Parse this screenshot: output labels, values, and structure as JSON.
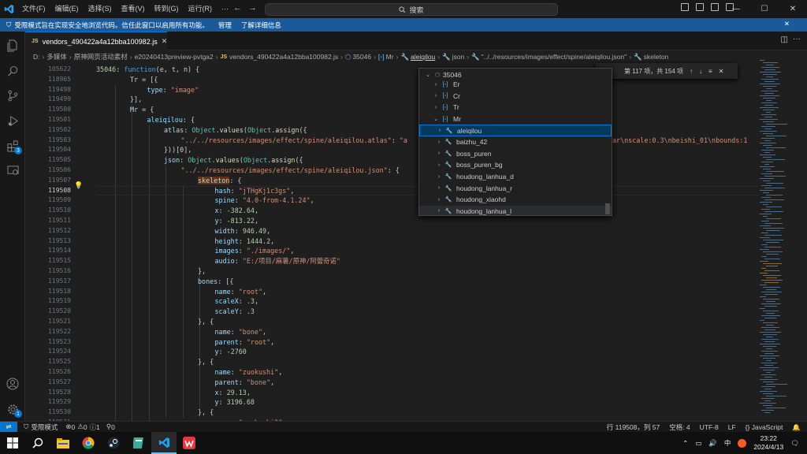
{
  "titlebar": {
    "menu": [
      "文件(F)",
      "编辑(E)",
      "选择(S)",
      "查看(V)",
      "转到(G)",
      "运行(R)",
      "···"
    ],
    "search_label": "搜索"
  },
  "banner": {
    "text": "受限模式旨在实现安全地浏览代码。信任此窗口以启用所有功能。",
    "manage": "管理",
    "learn_more": "了解详细信息"
  },
  "activity": {
    "extensions_badge": "3",
    "settings_badge": "1"
  },
  "tab": {
    "icon": "JS",
    "label": "vendors_490422a4a12bba100982.js"
  },
  "breadcrumb": [
    "D:",
    "多媒体",
    "原神网页活动素材",
    "e20240413preview-pvtga2",
    "vendors_490422a4a12bba100982.js",
    "35046",
    "Mr",
    "aleiqilou",
    "json",
    "\"../../resources/images/effect/spine/aleiqilou.json\"",
    "skeleton"
  ],
  "find": {
    "result": "第 117 项，共 154 项"
  },
  "editor": {
    "lines": [
      {
        "no": "105622",
        "indent": 0,
        "tokens": [
          [
            "n",
            "35046"
          ],
          [
            "",
            ": "
          ],
          [
            "k",
            "function"
          ],
          [
            "",
            "(e, t, n) {"
          ]
        ]
      },
      {
        "no": "118965",
        "indent": 2,
        "tokens": [
          [
            "p",
            "Tr"
          ],
          [
            "",
            " = [{"
          ]
        ]
      },
      {
        "no": "119498",
        "indent": 3,
        "tokens": [
          [
            "p",
            "type"
          ],
          [
            "",
            ": "
          ],
          [
            "s",
            "\"image\""
          ]
        ]
      },
      {
        "no": "119499",
        "indent": 2,
        "tokens": [
          [
            "",
            "}],"
          ]
        ]
      },
      {
        "no": "119500",
        "indent": 2,
        "tokens": [
          [
            "p",
            "Mr"
          ],
          [
            "",
            " = {"
          ]
        ]
      },
      {
        "no": "119501",
        "indent": 3,
        "tokens": [
          [
            "p",
            "aleiqilou"
          ],
          [
            "",
            ": {"
          ]
        ]
      },
      {
        "no": "119502",
        "indent": 4,
        "tokens": [
          [
            "p",
            "atlas"
          ],
          [
            "",
            ": "
          ],
          [
            "t",
            "Object"
          ],
          [
            "",
            "."
          ],
          [
            "f",
            "values"
          ],
          [
            "",
            "("
          ],
          [
            "t",
            "Object"
          ],
          [
            "",
            "."
          ],
          [
            "f",
            "assign"
          ],
          [
            "",
            "({"
          ]
        ]
      },
      {
        "no": "119503",
        "indent": 5,
        "tokens": [
          [
            "s",
            "\"../../resources/images/effect/spine/aleiqilou.atlas\""
          ],
          [
            "",
            ": "
          ],
          [
            "s",
            "\"a"
          ]
        ]
      },
      {
        "no": "119504",
        "indent": 4,
        "tokens": [
          [
            "",
            "}))[0],"
          ]
        ]
      },
      {
        "no": "119505",
        "indent": 4,
        "tokens": [
          [
            "p",
            "json"
          ],
          [
            "",
            ": "
          ],
          [
            "t",
            "Object"
          ],
          [
            "",
            "."
          ],
          [
            "f",
            "values"
          ],
          [
            "",
            "("
          ],
          [
            "t",
            "Object"
          ],
          [
            "",
            "."
          ],
          [
            "f",
            "assign"
          ],
          [
            "",
            "({"
          ]
        ]
      },
      {
        "no": "119506",
        "indent": 5,
        "tokens": [
          [
            "s",
            "\"../../resources/images/effect/spine/aleiqilou.json\""
          ],
          [
            "",
            ": {"
          ]
        ]
      },
      {
        "no": "119507",
        "indent": 6,
        "tokens": [
          [
            "p",
            "skeleton"
          ],
          [
            "",
            ": {"
          ]
        ]
      },
      {
        "no": "119508",
        "indent": 7,
        "tokens": [
          [
            "p",
            "hash"
          ],
          [
            "",
            ": "
          ],
          [
            "s",
            "\"jTHgKj1c3gs\""
          ],
          [
            "",
            ","
          ]
        ]
      },
      {
        "no": "119509",
        "indent": 7,
        "tokens": [
          [
            "p",
            "spine"
          ],
          [
            "",
            ": "
          ],
          [
            "s",
            "\"4.0-from-4.1.24\""
          ],
          [
            "",
            ","
          ]
        ]
      },
      {
        "no": "119510",
        "indent": 7,
        "tokens": [
          [
            "p",
            "x"
          ],
          [
            "",
            ": "
          ],
          [
            "n",
            "-382.64"
          ],
          [
            "",
            ","
          ]
        ]
      },
      {
        "no": "119511",
        "indent": 7,
        "tokens": [
          [
            "p",
            "y"
          ],
          [
            "",
            ": "
          ],
          [
            "n",
            "-813.22"
          ],
          [
            "",
            ","
          ]
        ]
      },
      {
        "no": "119512",
        "indent": 7,
        "tokens": [
          [
            "p",
            "width"
          ],
          [
            "",
            ": "
          ],
          [
            "n",
            "946.49"
          ],
          [
            "",
            ","
          ]
        ]
      },
      {
        "no": "119513",
        "indent": 7,
        "tokens": [
          [
            "p",
            "height"
          ],
          [
            "",
            ": "
          ],
          [
            "n",
            "1444.2"
          ],
          [
            "",
            ","
          ]
        ]
      },
      {
        "no": "119514",
        "indent": 7,
        "tokens": [
          [
            "p",
            "images"
          ],
          [
            "",
            ": "
          ],
          [
            "s",
            "\"./images/\""
          ],
          [
            "",
            ","
          ]
        ]
      },
      {
        "no": "119515",
        "indent": 7,
        "tokens": [
          [
            "p",
            "audio"
          ],
          [
            "",
            ": "
          ],
          [
            "s",
            "\"E:/项目/麻薯/原神/阿蕾奇诺\""
          ]
        ]
      },
      {
        "no": "119516",
        "indent": 6,
        "tokens": [
          [
            "",
            "},"
          ]
        ]
      },
      {
        "no": "119517",
        "indent": 6,
        "tokens": [
          [
            "p",
            "bones"
          ],
          [
            "",
            ": [{"
          ]
        ]
      },
      {
        "no": "119518",
        "indent": 7,
        "tokens": [
          [
            "p",
            "name"
          ],
          [
            "",
            ": "
          ],
          [
            "s",
            "\"root\""
          ],
          [
            "",
            ","
          ]
        ]
      },
      {
        "no": "119519",
        "indent": 7,
        "tokens": [
          [
            "p",
            "scaleX"
          ],
          [
            "",
            ": "
          ],
          [
            "n",
            ".3"
          ],
          [
            "",
            ","
          ]
        ]
      },
      {
        "no": "119520",
        "indent": 7,
        "tokens": [
          [
            "p",
            "scaleY"
          ],
          [
            "",
            ": "
          ],
          [
            "n",
            ".3"
          ]
        ]
      },
      {
        "no": "119521",
        "indent": 6,
        "tokens": [
          [
            "",
            "}, {"
          ]
        ]
      },
      {
        "no": "119522",
        "indent": 7,
        "tokens": [
          [
            "p",
            "name"
          ],
          [
            "",
            ": "
          ],
          [
            "s",
            "\"bone\""
          ],
          [
            "",
            ","
          ]
        ]
      },
      {
        "no": "119523",
        "indent": 7,
        "tokens": [
          [
            "p",
            "parent"
          ],
          [
            "",
            ": "
          ],
          [
            "s",
            "\"root\""
          ],
          [
            "",
            ","
          ]
        ]
      },
      {
        "no": "119524",
        "indent": 7,
        "tokens": [
          [
            "p",
            "y"
          ],
          [
            "",
            ": "
          ],
          [
            "n",
            "-2760"
          ]
        ]
      },
      {
        "no": "119525",
        "indent": 6,
        "tokens": [
          [
            "",
            "}, {"
          ]
        ]
      },
      {
        "no": "119526",
        "indent": 7,
        "tokens": [
          [
            "p",
            "name"
          ],
          [
            "",
            ": "
          ],
          [
            "s",
            "\"zuokushi\""
          ],
          [
            "",
            ","
          ]
        ]
      },
      {
        "no": "119527",
        "indent": 7,
        "tokens": [
          [
            "p",
            "parent"
          ],
          [
            "",
            ": "
          ],
          [
            "s",
            "\"bone\""
          ],
          [
            "",
            ","
          ]
        ]
      },
      {
        "no": "119528",
        "indent": 7,
        "tokens": [
          [
            "p",
            "x"
          ],
          [
            "",
            ": "
          ],
          [
            "n",
            "29.13"
          ],
          [
            "",
            ","
          ]
        ]
      },
      {
        "no": "119529",
        "indent": 7,
        "tokens": [
          [
            "p",
            "y"
          ],
          [
            "",
            ": "
          ],
          [
            "n",
            "3196.68"
          ]
        ]
      },
      {
        "no": "119530",
        "indent": 6,
        "tokens": [
          [
            "",
            "}, {"
          ]
        ]
      },
      {
        "no": "119531",
        "indent": 7,
        "tokens": [
          [
            "p",
            "name"
          ],
          [
            "",
            ": "
          ],
          [
            "s",
            "\"zuokushi3\""
          ],
          [
            "",
            ","
          ]
        ]
      }
    ],
    "atlas_tail": "ar\\nscale:0.3\\nbeishi_01\\nbounds:1"
  },
  "peek": {
    "header": "35046",
    "items": [
      {
        "label": "Er",
        "kind": "var",
        "level": 1
      },
      {
        "label": "Cr",
        "kind": "var",
        "level": 1
      },
      {
        "label": "Tr",
        "kind": "var",
        "level": 1
      },
      {
        "label": "Mr",
        "kind": "var",
        "level": 1,
        "open": true
      },
      {
        "label": "aleiqilou",
        "kind": "prop",
        "level": 2,
        "selected": true
      },
      {
        "label": "baizhu_42",
        "kind": "prop",
        "level": 2
      },
      {
        "label": "boss_puren",
        "kind": "prop",
        "level": 2
      },
      {
        "label": "boss_puren_bg",
        "kind": "prop",
        "level": 2
      },
      {
        "label": "houdong_lanhua_d",
        "kind": "prop",
        "level": 2
      },
      {
        "label": "houdong_lanhua_r",
        "kind": "prop",
        "level": 2
      },
      {
        "label": "houdong_xiaohd",
        "kind": "prop",
        "level": 2
      },
      {
        "label": "houdong_lanhua_l",
        "kind": "prop",
        "level": 2,
        "hover": true
      }
    ]
  },
  "statusbar": {
    "restricted": "受限模式",
    "errors": "0",
    "warnings": "0",
    "info": "1",
    "ports": "0",
    "position": "行 119508，列 57",
    "spaces": "空格: 4",
    "encoding": "UTF-8",
    "eol": "LF",
    "language": "JavaScript"
  },
  "taskbar": {
    "ime": "中",
    "time": "23:22",
    "date": "2024/4/13"
  },
  "colors": {
    "accent": "#0078d4",
    "banner": "#1a5a9a",
    "editor_bg": "#1f1f1f"
  }
}
